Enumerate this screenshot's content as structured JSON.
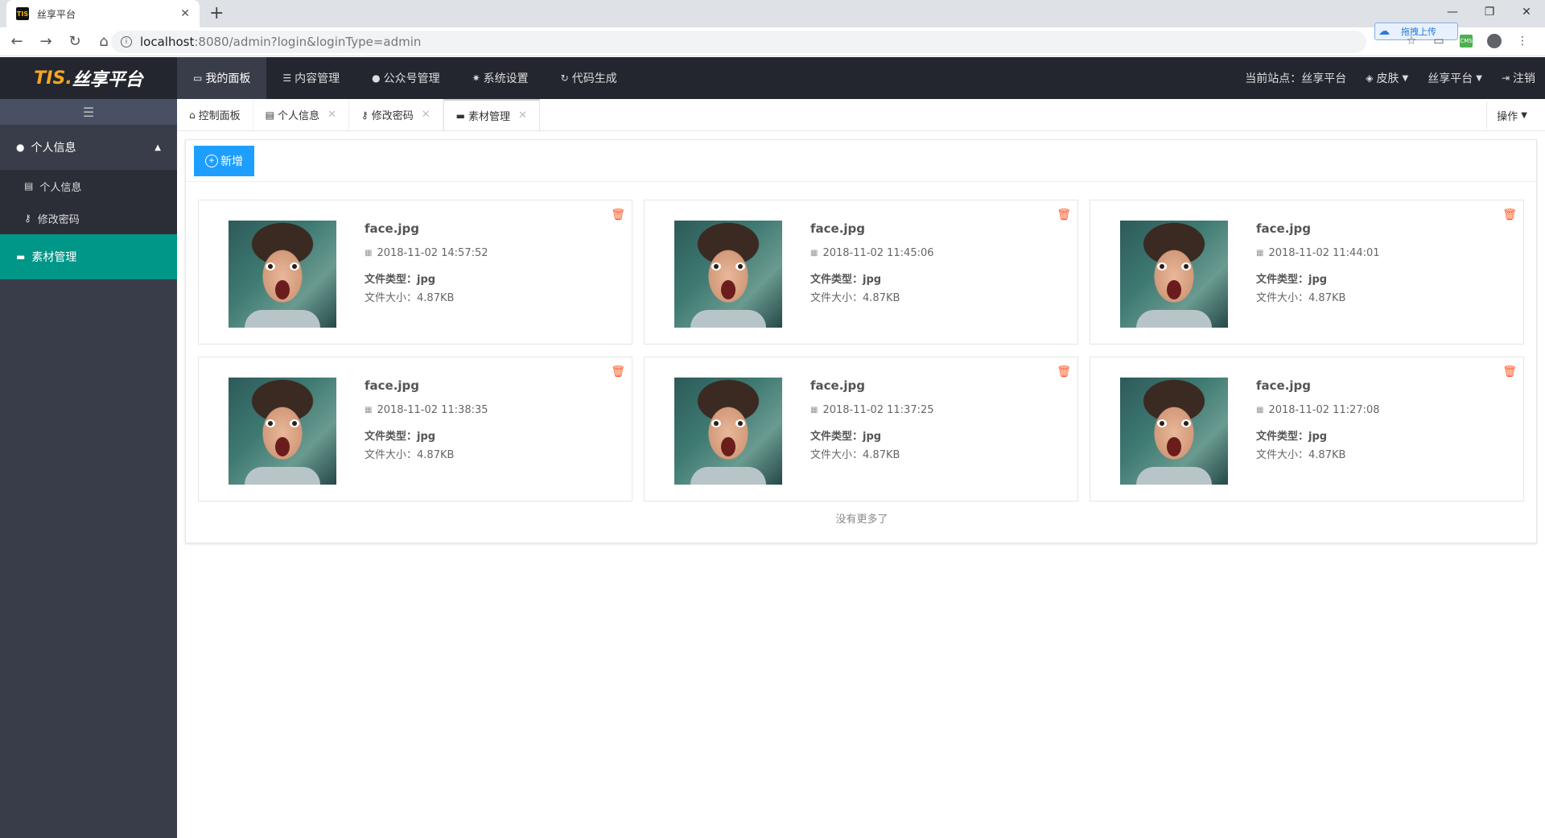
{
  "browser": {
    "tab_title": "丝享平台",
    "favicon_text": "TIS",
    "url_host": "localhost",
    "url_rest": ":8080/admin?login&loginType=admin",
    "upload_label": "拖拽上传",
    "ext_badge": "CMS"
  },
  "header": {
    "logo_main": "TIS.",
    "logo_sub": "丝享平台",
    "nav": [
      {
        "label": "我的面板",
        "icon": "desktop-icon"
      },
      {
        "label": "内容管理",
        "icon": "list-icon"
      },
      {
        "label": "公众号管理",
        "icon": "wechat-icon"
      },
      {
        "label": "系统设置",
        "icon": "gear-icon"
      },
      {
        "label": "代码生成",
        "icon": "refresh-icon"
      }
    ],
    "current_site": "当前站点：丝享平台",
    "skin": "皮肤",
    "user": "丝享平台",
    "logout": "注销"
  },
  "sidebar": {
    "group_label": "个人信息",
    "items": [
      "个人信息",
      "修改密码"
    ],
    "active_label": "素材管理"
  },
  "tabs": {
    "items": [
      "控制面板",
      "个人信息",
      "修改密码",
      "素材管理"
    ],
    "ops": "操作"
  },
  "content": {
    "add_label": "新增",
    "type_label": "文件类型：",
    "size_label": "文件大小：",
    "no_more": "没有更多了",
    "cards": [
      {
        "name": "face.jpg",
        "date": "2018-11-02 14:57:52",
        "type": "jpg",
        "size": "4.87KB"
      },
      {
        "name": "face.jpg",
        "date": "2018-11-02 11:45:06",
        "type": "jpg",
        "size": "4.87KB"
      },
      {
        "name": "face.jpg",
        "date": "2018-11-02 11:44:01",
        "type": "jpg",
        "size": "4.87KB"
      },
      {
        "name": "face.jpg",
        "date": "2018-11-02 11:38:35",
        "type": "jpg",
        "size": "4.87KB"
      },
      {
        "name": "face.jpg",
        "date": "2018-11-02 11:37:25",
        "type": "jpg",
        "size": "4.87KB"
      },
      {
        "name": "face.jpg",
        "date": "2018-11-02 11:27:08",
        "type": "jpg",
        "size": "4.87KB"
      }
    ]
  }
}
